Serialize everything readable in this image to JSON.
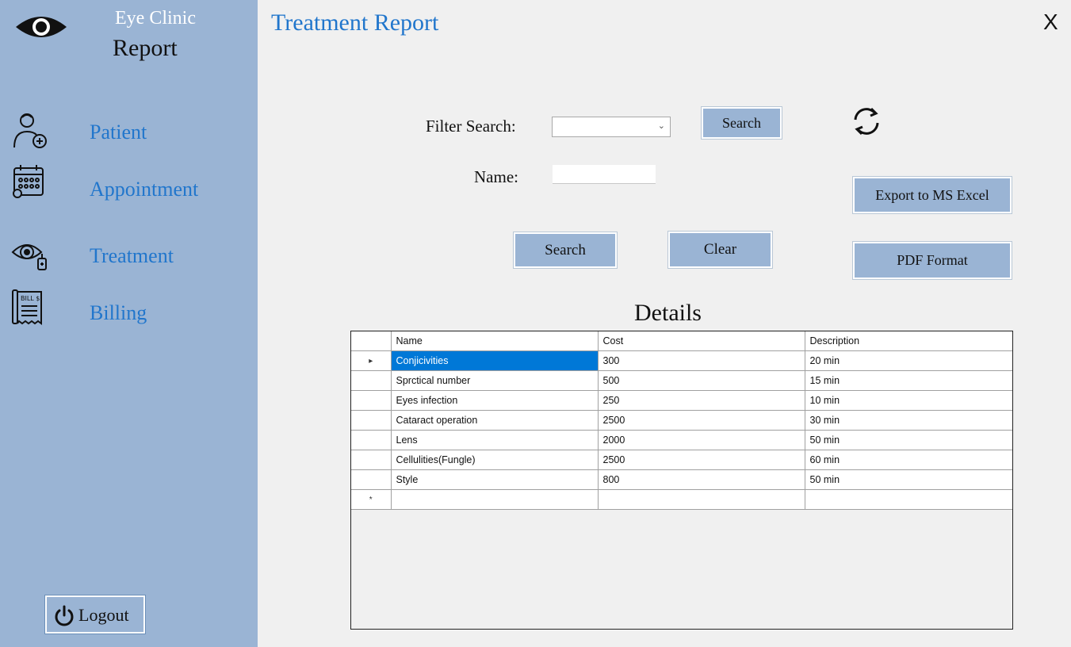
{
  "sidebar": {
    "clinic_name": "Eye Clinic",
    "clinic_subtitle": "Report",
    "items": [
      {
        "label": "Patient",
        "icon": "patient-icon"
      },
      {
        "label": "Appointment",
        "icon": "calendar-icon"
      },
      {
        "label": "Treatment",
        "icon": "eye-drop-icon"
      },
      {
        "label": "Billing",
        "icon": "bill-icon"
      }
    ],
    "bill_icon_text": "BILL $",
    "logout_label": "Logout"
  },
  "header": {
    "title": "Treatment Report",
    "close_label": "X"
  },
  "filters": {
    "filter_label": "Filter Search:",
    "filter_value": "",
    "filter_search_label": "Search",
    "name_label": "Name:",
    "name_value": "",
    "search_label": "Search",
    "clear_label": "Clear"
  },
  "actions": {
    "excel_label": "Export to MS Excel",
    "pdf_label": "PDF Format"
  },
  "details": {
    "title": "Details",
    "columns": [
      "Name",
      "Cost",
      "Description"
    ],
    "rows": [
      [
        "Conjicivities",
        "300",
        "20 min"
      ],
      [
        "Sprctical number",
        "500",
        "15 min"
      ],
      [
        "Eyes infection",
        "250",
        "10 min"
      ],
      [
        "Cataract operation",
        "2500",
        "30 min"
      ],
      [
        "Lens",
        "2000",
        "50 min"
      ],
      [
        "Cellulities(Fungle)",
        "2500",
        "60 min"
      ],
      [
        "Style",
        "800",
        "50 min"
      ]
    ],
    "selected_row": 0,
    "current_row_marker": "▸",
    "new_row_marker": "*"
  },
  "colors": {
    "sidebar_bg": "#9ab4d4",
    "accent": "#2176cc",
    "selection": "#0078d7"
  }
}
